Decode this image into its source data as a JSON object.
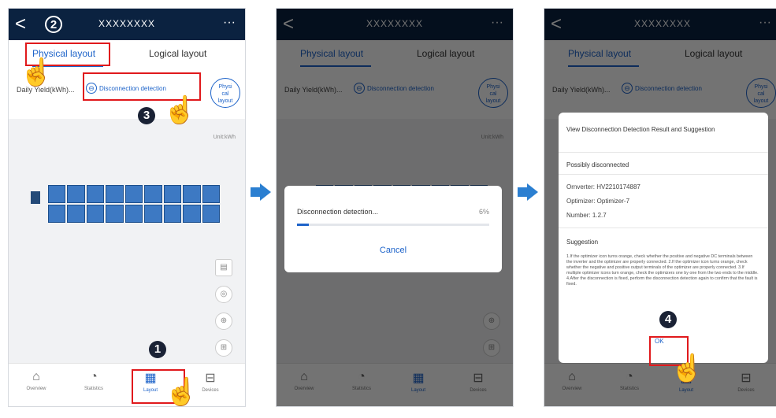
{
  "header": {
    "title": "XXXXXXXX",
    "back_glyph": "<",
    "more_glyph": "···"
  },
  "tabs": {
    "physical": "Physical layout",
    "logical": "Logical layout"
  },
  "toolbar": {
    "daily_label": "Daily Yield(kWh)...",
    "detection_label": "Disconnection detection",
    "phys_btn_lines": [
      "Physi",
      "cal",
      "layout"
    ]
  },
  "canvas": {
    "unit_label": "Unit:kWh",
    "cols": 9,
    "rows": 2
  },
  "nav": {
    "items": [
      "Overview",
      "Statistics",
      "Layout",
      "Devices"
    ]
  },
  "steps": {
    "s1": "1",
    "s2": "2",
    "s3": "3",
    "s4": "4"
  },
  "progress_dialog": {
    "text": "Disconnection detection...",
    "percent_text": "6%",
    "progress": 6,
    "cancel": "Cancel"
  },
  "result_dialog": {
    "title": "View Disconnection Detection Result and Suggestion",
    "status": "Possibly disconnected",
    "inverter": "Ornverter: HV2210174887",
    "optimizer": "Optimizer: Optimizer-7",
    "number": "Number: 1.2.7",
    "suggestion_heading": "Suggestion",
    "suggestion_text": "1.If the optimizer icon turns orange, check whether the positive and negative DC terminals between the inverter and the optimizer are properly connected. 2.If the optimizer icon turns orange, check whether the negative and positive output terminals of the optimizer are properly connected. 3.If multiple optimizer icons turn orange, check the optimizers one by one from the two ends to the middle. 4.After the disconnection is fixed, perform the disconnection detection again to confirm that the fault is fixed.",
    "ok": "OK"
  },
  "colors": {
    "header_bg": "#0b2240",
    "accent": "#1d63c9",
    "highlight": "#e0191c"
  }
}
